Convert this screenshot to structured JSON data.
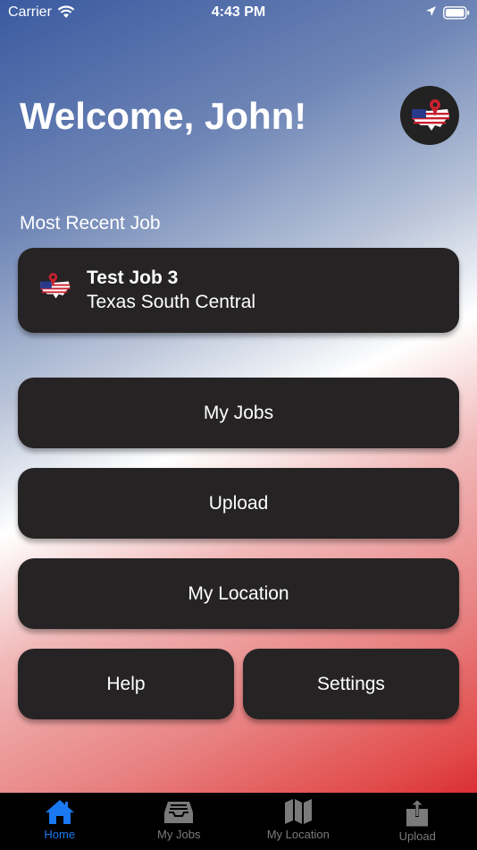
{
  "status": {
    "carrier": "Carrier",
    "time": "4:43 PM"
  },
  "header": {
    "welcome": "Welcome, John!"
  },
  "recent": {
    "label": "Most Recent Job",
    "job_title": "Test Job 3",
    "job_subtitle": "Texas South Central"
  },
  "buttons": {
    "my_jobs": "My Jobs",
    "upload": "Upload",
    "my_location": "My Location",
    "help": "Help",
    "settings": "Settings"
  },
  "tabs": [
    {
      "label": "Home",
      "icon": "home-icon",
      "active": true
    },
    {
      "label": "My Jobs",
      "icon": "tray-icon",
      "active": false
    },
    {
      "label": "My Location",
      "icon": "map-icon",
      "active": false
    },
    {
      "label": "Upload",
      "icon": "upload-icon",
      "active": false
    }
  ],
  "colors": {
    "card": "#262324",
    "tab_active": "#1a78f2",
    "tab_inactive": "#7a7a7a"
  }
}
